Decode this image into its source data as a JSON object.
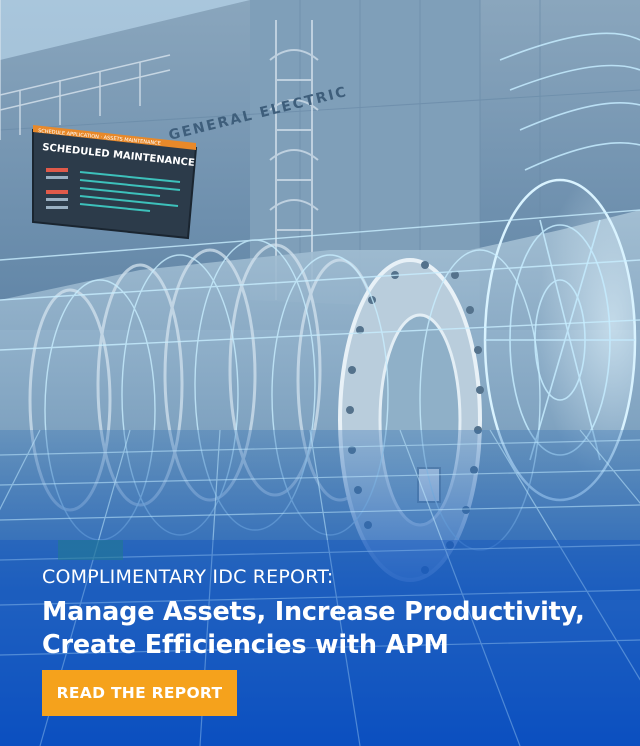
{
  "scene": {
    "building_lettering": "GENERAL ELECTRIC",
    "sign_small": "SCHEDULE APPLICATION · ASSETS MAINTENANCE",
    "sign_title": "SCHEDULED MAINTENANCE"
  },
  "copy": {
    "eyebrow": "COMPLIMENTARY IDC REPORT:",
    "headline_line1": "Manage Assets, Increase Productivity,",
    "headline_line2": "Create Efficiencies with APM"
  },
  "cta": {
    "label": "READ THE REPORT"
  },
  "colors": {
    "cta_background": "#f5a21c",
    "text": "#ffffff",
    "bottom_blue": "#0b4fc0",
    "wireframe": "#bfe9ff"
  }
}
